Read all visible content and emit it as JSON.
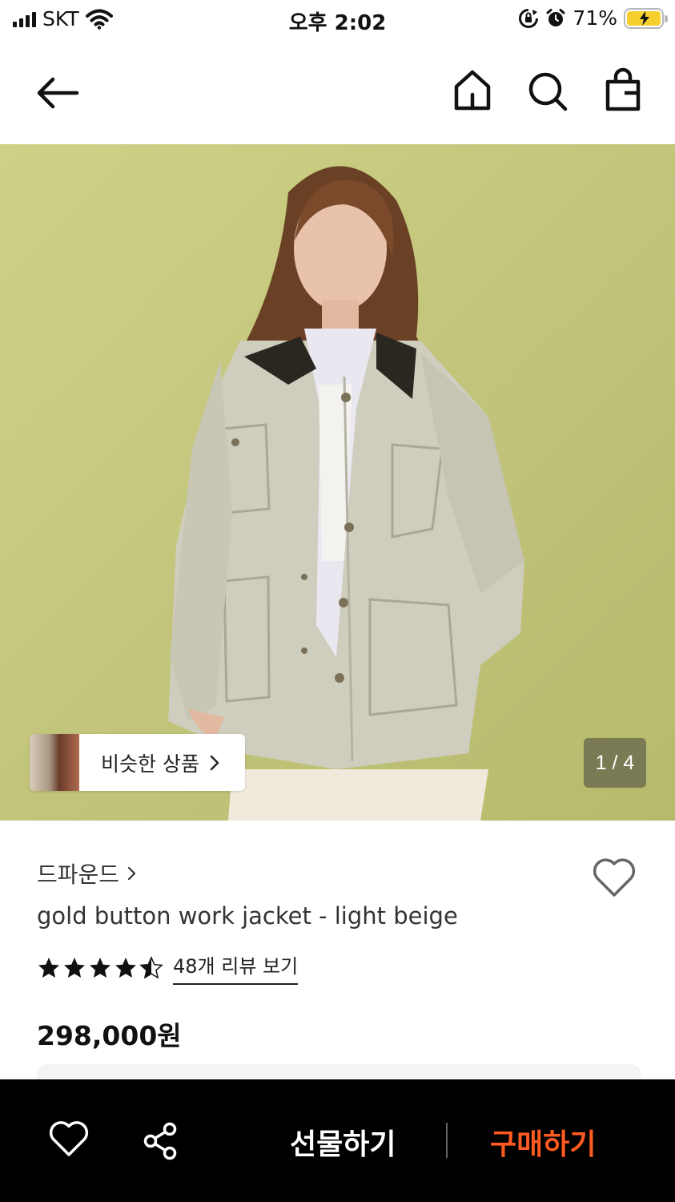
{
  "status_bar": {
    "carrier": "SKT",
    "time": "오후 2:02",
    "battery_percent": "71%",
    "battery_level": 0.71,
    "icons": [
      "signal-icon",
      "wifi-icon",
      "rotation-lock-icon",
      "alarm-icon",
      "battery-charging-icon"
    ]
  },
  "nav": {
    "icons": [
      "back-arrow-icon",
      "home-icon",
      "search-icon",
      "shopping-bag-icon"
    ]
  },
  "hero": {
    "similar_label": "비슷한 상품",
    "page_counter": "1 / 4",
    "current_page": 1,
    "total_pages": 4
  },
  "product": {
    "brand": "드파운드",
    "title": "gold button work jacket - light beige",
    "rating": 4.5,
    "review_link": "48개 리뷰 보기",
    "price": "298,000원"
  },
  "bottom_bar": {
    "gift_label": "선물하기",
    "buy_label": "구매하기",
    "buy_color": "#ff5a1f"
  },
  "colors": {
    "hero_background": "#c3c67c",
    "accent": "#ff5a1f",
    "bottom_bar": "#000000"
  }
}
